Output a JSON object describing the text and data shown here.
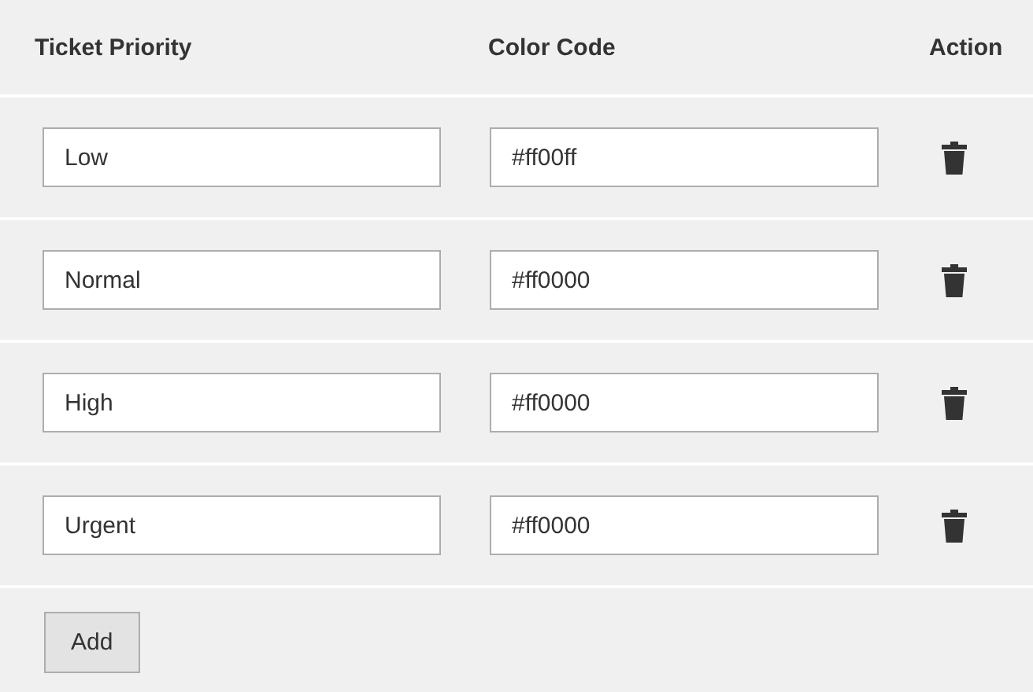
{
  "table": {
    "columns": [
      "Ticket Priority",
      "Color Code",
      "Action"
    ],
    "rows": [
      {
        "priority": "Low",
        "color_code": "#ff00ff"
      },
      {
        "priority": "Normal",
        "color_code": "#ff0000"
      },
      {
        "priority": "High",
        "color_code": "#ff0000"
      },
      {
        "priority": "Urgent",
        "color_code": "#ff0000"
      }
    ]
  },
  "buttons": [
    "Add"
  ]
}
